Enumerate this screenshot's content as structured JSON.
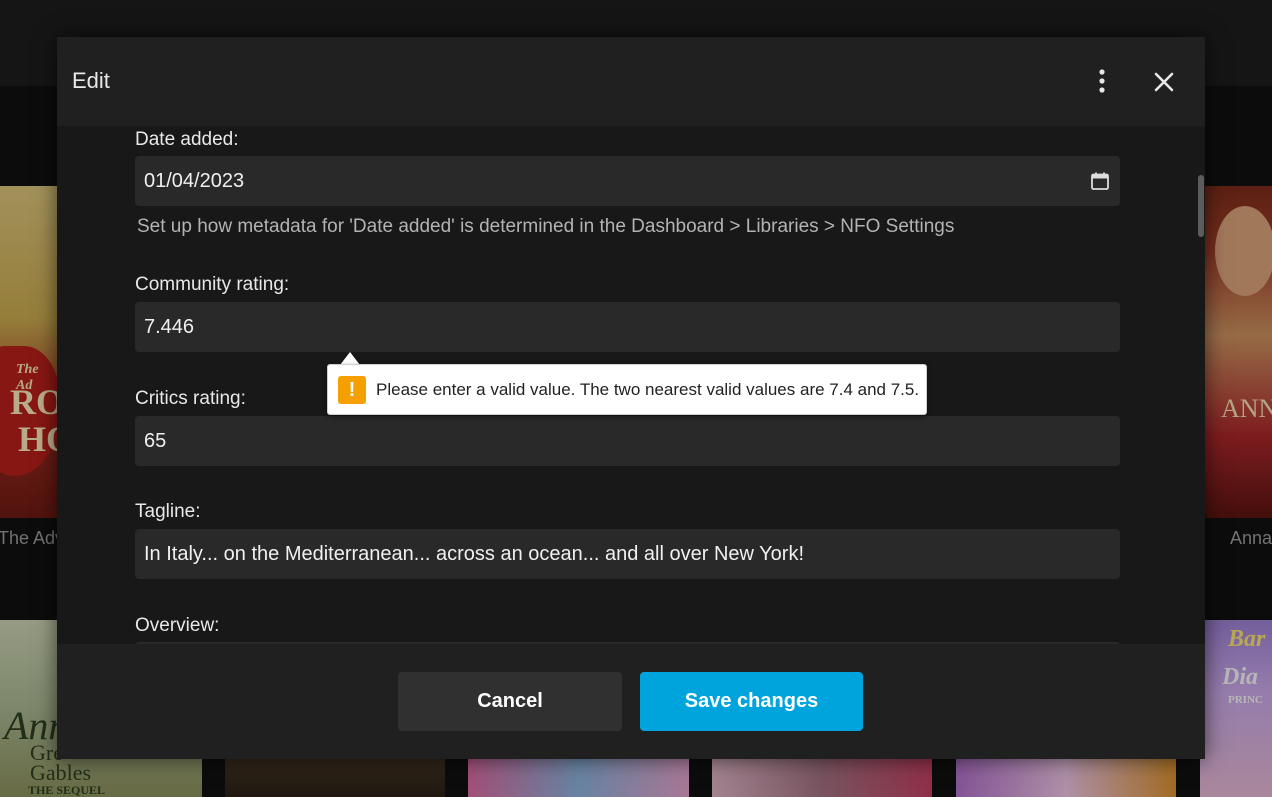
{
  "background": {
    "left_caption": "The Adv",
    "right_caption": "Anna",
    "posters": [
      {
        "name": "robin-hood-poster",
        "text1": "The Ad",
        "text2": "RO",
        "text3": "HO"
      },
      {
        "name": "anna-poster",
        "text1": "ANN"
      },
      {
        "name": "anne-green-gables-poster",
        "text1": "Ann",
        "text2": "Gre",
        "text3": "Gables",
        "text4": "THE SEQUEL"
      },
      {
        "name": "barbie-princess-poster",
        "text1": "Bar",
        "text2": "Dia",
        "text3": "PRINC"
      }
    ]
  },
  "dialog": {
    "title": "Edit",
    "more_icon": "more-vertical-icon",
    "close_icon": "close-icon"
  },
  "form": {
    "date_added": {
      "label": "Date added:",
      "value": "01/04/2023",
      "help": "Set up how metadata for 'Date added' is determined in the Dashboard > Libraries > NFO Settings",
      "icon": "calendar-icon"
    },
    "community_rating": {
      "label": "Community rating:",
      "value": "7.446"
    },
    "critics_rating": {
      "label": "Critics rating:",
      "value": "65"
    },
    "tagline": {
      "label": "Tagline:",
      "value": "In Italy... on the Mediterranean... across an ocean... and all over New York!"
    },
    "overview": {
      "label": "Overview:"
    }
  },
  "validation_tooltip": {
    "icon": "warning-icon",
    "icon_glyph": "!",
    "message": "Please enter a valid value. The two nearest valid values are 7.4 and 7.5."
  },
  "footer": {
    "cancel_label": "Cancel",
    "save_label": "Save changes"
  },
  "colors": {
    "accent": "#00a4dc",
    "warning": "#f5a000",
    "dialog_bg": "#181818",
    "input_bg": "#292929"
  }
}
